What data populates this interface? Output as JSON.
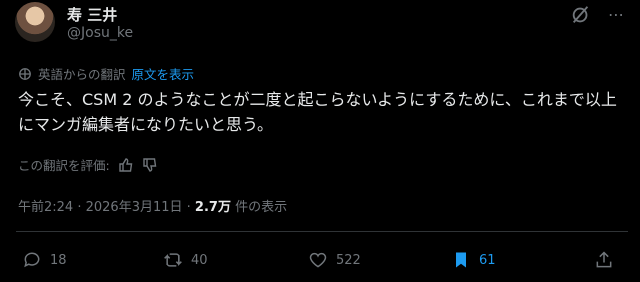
{
  "author": {
    "name": "寿 三井",
    "handle": "@Josu_ke"
  },
  "translation": {
    "from_label": "英語からの翻訳",
    "original_link": "原文を表示"
  },
  "post_text": "今こそ、CSM 2 のようなことが二度と起こらないようにするために、これまで以上にマンガ編集者になりたいと思う。",
  "rating": {
    "prompt": "この翻訳を評価:"
  },
  "meta": {
    "time": "午前2:24",
    "sep1": " · ",
    "date": "2026年3月11日",
    "sep2": " · ",
    "views": "2.7万",
    "views_label": " 件の表示"
  },
  "actions": {
    "replies": "18",
    "reposts": "40",
    "likes": "522",
    "bookmarks": "61"
  },
  "colors": {
    "accent": "#1d9bf0",
    "text": "#e7e9ea",
    "muted": "#71767b",
    "border": "#2f3336"
  }
}
